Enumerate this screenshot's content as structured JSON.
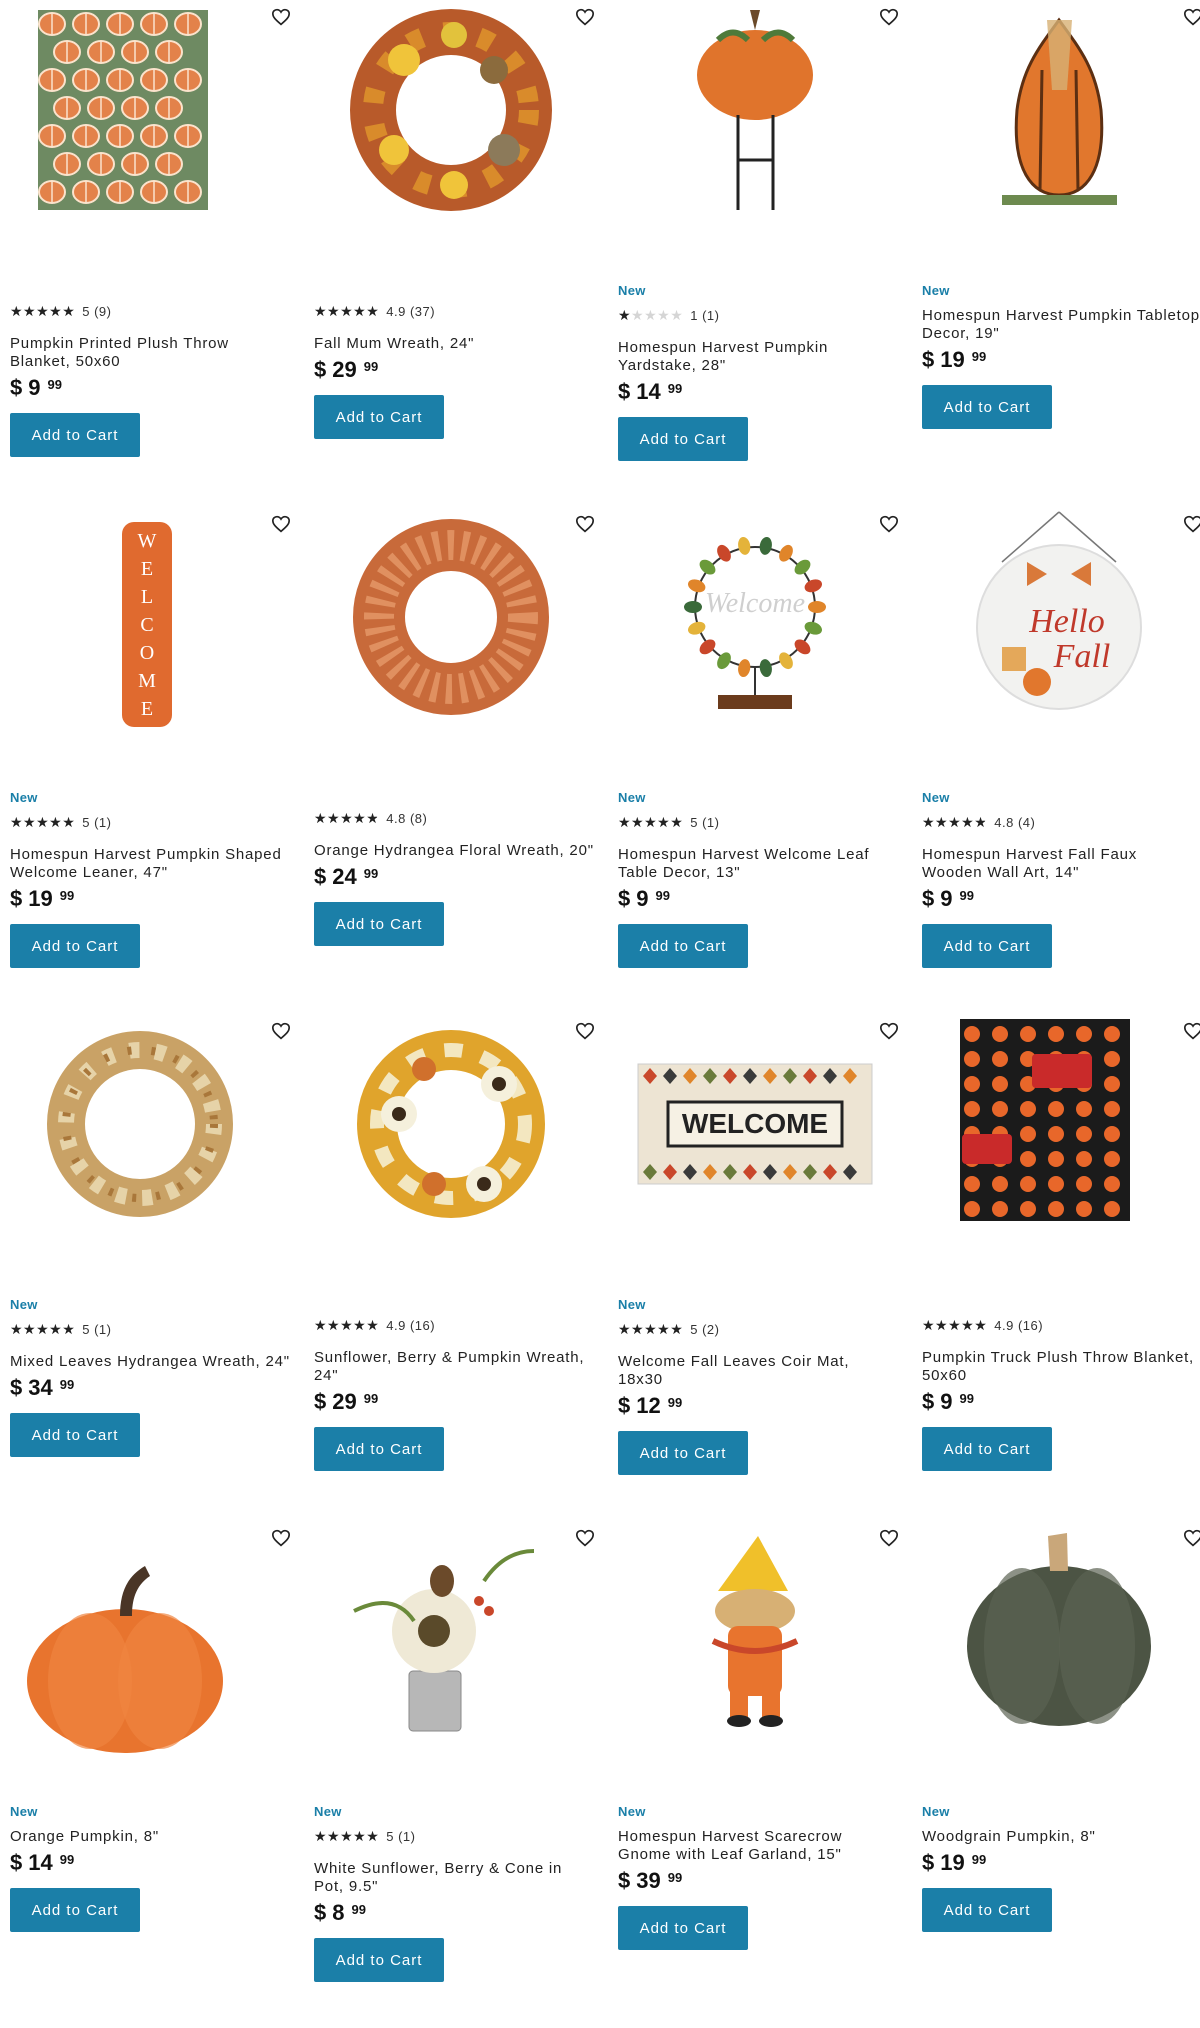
{
  "accent_color": "#1b7fa8",
  "add_to_cart_label": "Add to Cart",
  "favorite_icon": "heart-outline-icon",
  "products": [
    {
      "name": "Pumpkin Printed Plush Throw Blanket, 50x60",
      "badge": "",
      "rating": 5,
      "rating_text": "5 (9)",
      "dollars": "9",
      "cents": "99",
      "image": "pumpkin-blanket-green"
    },
    {
      "name": "Fall Mum Wreath, 24\"",
      "badge": "",
      "rating": 4.9,
      "rating_text": "4.9 (37)",
      "dollars": "29",
      "cents": "99",
      "image": "mum-wreath"
    },
    {
      "name": "Homespun Harvest Pumpkin Yardstake, 28\"",
      "badge": "New",
      "rating": 1,
      "rating_text": "1 (1)",
      "dollars": "14",
      "cents": "99",
      "image": "pumpkin-yardstake"
    },
    {
      "name": "Homespun Harvest Pumpkin Tabletop Decor, 19\"",
      "badge": "New",
      "rating": null,
      "rating_text": "",
      "dollars": "19",
      "cents": "99",
      "image": "gourd-tabletop"
    },
    {
      "name": "Homespun Harvest Pumpkin Shaped Welcome Leaner, 47\"",
      "badge": "New",
      "rating": 5,
      "rating_text": "5 (1)",
      "dollars": "19",
      "cents": "99",
      "image": "welcome-leaner"
    },
    {
      "name": "Orange Hydrangea Floral Wreath, 20\"",
      "badge": "",
      "rating": 4.8,
      "rating_text": "4.8 (8)",
      "dollars": "24",
      "cents": "99",
      "image": "hydrangea-wreath"
    },
    {
      "name": "Homespun Harvest Welcome Leaf Table Decor, 13\"",
      "badge": "New",
      "rating": 5,
      "rating_text": "5 (1)",
      "dollars": "9",
      "cents": "99",
      "image": "leaf-table-decor"
    },
    {
      "name": "Homespun Harvest Fall Faux Wooden Wall Art, 14\"",
      "badge": "New",
      "rating": 4.8,
      "rating_text": "4.8 (4)",
      "dollars": "9",
      "cents": "99",
      "image": "hello-fall-sign"
    },
    {
      "name": "Mixed Leaves Hydrangea Wreath, 24\"",
      "badge": "New",
      "rating": 5,
      "rating_text": "5 (1)",
      "dollars": "34",
      "cents": "99",
      "image": "mixed-leaves-wreath"
    },
    {
      "name": "Sunflower, Berry & Pumpkin Wreath, 24\"",
      "badge": "",
      "rating": 4.9,
      "rating_text": "4.9 (16)",
      "dollars": "29",
      "cents": "99",
      "image": "sunflower-wreath"
    },
    {
      "name": "Welcome Fall Leaves Coir Mat, 18x30",
      "badge": "New",
      "rating": 5,
      "rating_text": "5 (2)",
      "dollars": "12",
      "cents": "99",
      "image": "welcome-mat"
    },
    {
      "name": "Pumpkin Truck Plush Throw Blanket, 50x60",
      "badge": "",
      "rating": 4.9,
      "rating_text": "4.9 (16)",
      "dollars": "9",
      "cents": "99",
      "image": "truck-blanket"
    },
    {
      "name": "Orange Pumpkin, 8\"",
      "badge": "New",
      "rating": null,
      "rating_text": "",
      "dollars": "14",
      "cents": "99",
      "image": "orange-pumpkin"
    },
    {
      "name": "White Sunflower, Berry & Cone in Pot, 9.5\"",
      "badge": "New",
      "rating": 5,
      "rating_text": "5 (1)",
      "dollars": "8",
      "cents": "99",
      "image": "sunflower-pot"
    },
    {
      "name": "Homespun Harvest Scarecrow Gnome with Leaf Garland, 15\"",
      "badge": "New",
      "rating": null,
      "rating_text": "",
      "dollars": "39",
      "cents": "99",
      "image": "scarecrow-gnome"
    },
    {
      "name": "Woodgrain Pumpkin, 8\"",
      "badge": "New",
      "rating": null,
      "rating_text": "",
      "dollars": "19",
      "cents": "99",
      "image": "woodgrain-pumpkin"
    }
  ]
}
